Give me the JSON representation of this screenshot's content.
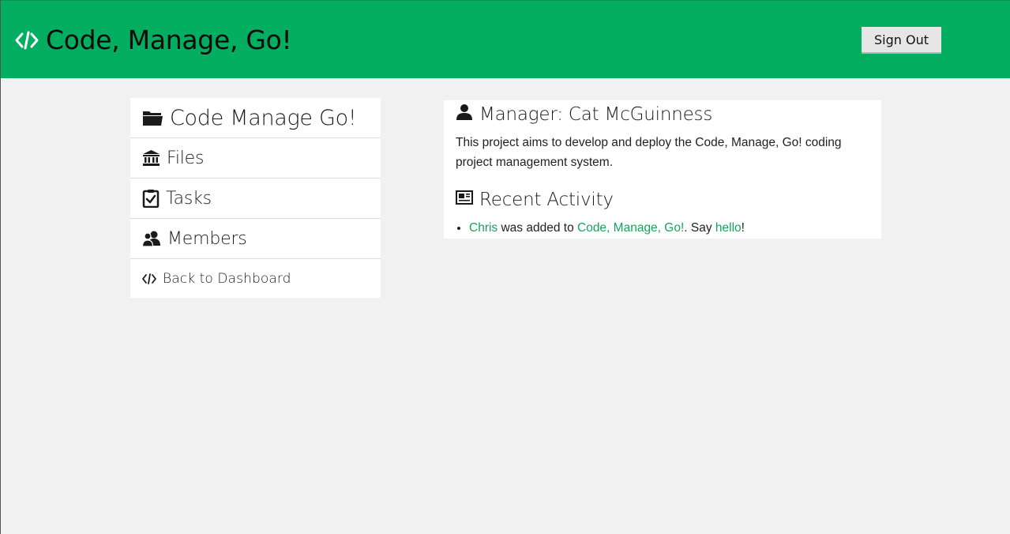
{
  "header": {
    "title": "Code, Manage, Go!",
    "brand_icon": "code-icon",
    "signout_label": "Sign Out"
  },
  "sidebar": {
    "project": {
      "label": "Code Manage Go!",
      "icon": "folder-icon"
    },
    "items": [
      {
        "label": "Files",
        "icon": "bank-icon"
      },
      {
        "label": "Tasks",
        "icon": "clipboard-check-icon"
      },
      {
        "label": "Members",
        "icon": "users-icon"
      }
    ],
    "back": {
      "label": "Back to Dashboard",
      "icon": "code-icon"
    }
  },
  "main": {
    "manager_heading": "Manager: Cat McGuinness",
    "description": "This project aims to develop and deploy the Code, Manage, Go! coding project management system.",
    "activity_heading": "Recent Activity",
    "activity": [
      {
        "user": "Chris",
        "text1": " was added to ",
        "project": "Code, Manage, Go!",
        "text2": ". Say ",
        "link": "hello",
        "text3": "!"
      }
    ]
  },
  "colors": {
    "accent": "#03ae61",
    "link": "#1aa15a",
    "background": "#f1f1f1"
  }
}
